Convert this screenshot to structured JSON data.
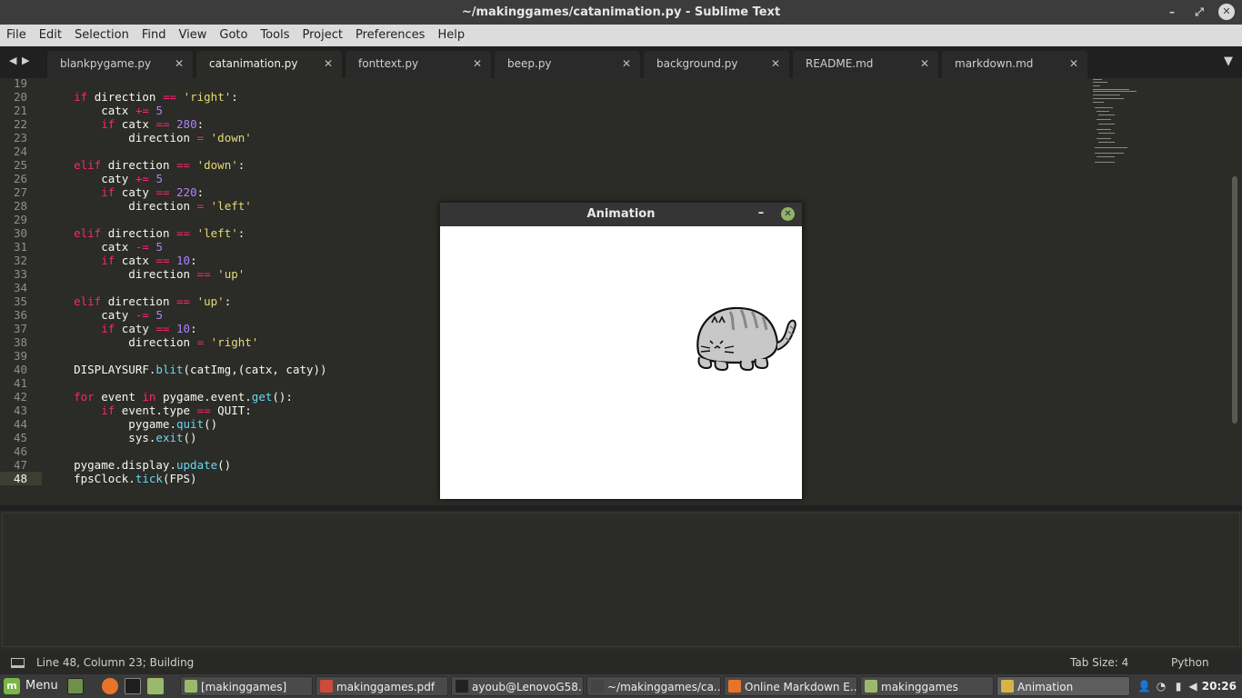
{
  "window": {
    "title": "~/makinggames/catanimation.py - Sublime Text"
  },
  "menu": [
    "File",
    "Edit",
    "Selection",
    "Find",
    "View",
    "Goto",
    "Tools",
    "Project",
    "Preferences",
    "Help"
  ],
  "tabs": [
    {
      "label": "blankpygame.py",
      "active": false
    },
    {
      "label": "catanimation.py",
      "active": true
    },
    {
      "label": "fonttext.py",
      "active": false
    },
    {
      "label": "beep.py",
      "active": false
    },
    {
      "label": "background.py",
      "active": false
    },
    {
      "label": "README.md",
      "active": false
    },
    {
      "label": "markdown.md",
      "active": false
    }
  ],
  "editor": {
    "current_line": "48",
    "lines": [
      {
        "n": "19",
        "html": ""
      },
      {
        "n": "20",
        "html": "    <span class=\"kw\">if</span> direction <span class=\"kw\">==</span> <span class=\"st\">'right'</span>:"
      },
      {
        "n": "21",
        "html": "        catx <span class=\"kw\">+=</span> <span class=\"nm\">5</span>"
      },
      {
        "n": "22",
        "html": "        <span class=\"kw\">if</span> catx <span class=\"kw\">==</span> <span class=\"nm\">280</span>:"
      },
      {
        "n": "23",
        "html": "            direction <span class=\"kw\">=</span> <span class=\"st\">'down'</span>"
      },
      {
        "n": "24",
        "html": ""
      },
      {
        "n": "25",
        "html": "    <span class=\"kw\">elif</span> direction <span class=\"kw\">==</span> <span class=\"st\">'down'</span>:"
      },
      {
        "n": "26",
        "html": "        caty <span class=\"kw\">+=</span> <span class=\"nm\">5</span>"
      },
      {
        "n": "27",
        "html": "        <span class=\"kw\">if</span> caty <span class=\"kw\">==</span> <span class=\"nm\">220</span>:"
      },
      {
        "n": "28",
        "html": "            direction <span class=\"kw\">=</span> <span class=\"st\">'left'</span>"
      },
      {
        "n": "29",
        "html": ""
      },
      {
        "n": "30",
        "html": "    <span class=\"kw\">elif</span> direction <span class=\"kw\">==</span> <span class=\"st\">'left'</span>:"
      },
      {
        "n": "31",
        "html": "        catx <span class=\"kw\">-=</span> <span class=\"nm\">5</span>"
      },
      {
        "n": "32",
        "html": "        <span class=\"kw\">if</span> catx <span class=\"kw\">==</span> <span class=\"nm\">10</span>:"
      },
      {
        "n": "33",
        "html": "            direction <span class=\"kw\">==</span> <span class=\"st\">'up'</span>"
      },
      {
        "n": "34",
        "html": ""
      },
      {
        "n": "35",
        "html": "    <span class=\"kw\">elif</span> direction <span class=\"kw\">==</span> <span class=\"st\">'up'</span>:"
      },
      {
        "n": "36",
        "html": "        caty <span class=\"kw\">-=</span> <span class=\"nm\">5</span>"
      },
      {
        "n": "37",
        "html": "        <span class=\"kw\">if</span> caty <span class=\"kw\">==</span> <span class=\"nm\">10</span>:"
      },
      {
        "n": "38",
        "html": "            direction <span class=\"kw\">=</span> <span class=\"st\">'right'</span>"
      },
      {
        "n": "39",
        "html": ""
      },
      {
        "n": "40",
        "html": "    DISPLAYSURF.<span class=\"fn\">blit</span>(catImg,(catx, caty))"
      },
      {
        "n": "41",
        "html": ""
      },
      {
        "n": "42",
        "html": "    <span class=\"kw\">for</span> event <span class=\"kw\">in</span> pygame.event.<span class=\"fn\">get</span>():"
      },
      {
        "n": "43",
        "html": "        <span class=\"kw\">if</span> event.type <span class=\"kw\">==</span> QUIT:"
      },
      {
        "n": "44",
        "html": "            pygame.<span class=\"fn\">quit</span>()"
      },
      {
        "n": "45",
        "html": "            sys.<span class=\"fn\">exit</span>()"
      },
      {
        "n": "46",
        "html": ""
      },
      {
        "n": "47",
        "html": "    pygame.display.<span class=\"fn\">update</span>()"
      },
      {
        "n": "48",
        "html": "    fpsClock.<span class=\"fn\">tick</span>(FPS)"
      }
    ]
  },
  "statusbar": {
    "position": "Line 48, Column 23; Building",
    "tab_size": "Tab Size: 4",
    "syntax": "Python"
  },
  "animation_window": {
    "title": "Animation",
    "minimize": "–",
    "close": "✕"
  },
  "taskbar": {
    "menu_label": "Menu",
    "tasks": [
      {
        "label": "[makinggames]",
        "icon_color": "#9cb86a",
        "active": false
      },
      {
        "label": "makinggames.pdf",
        "icon_color": "#d04a3a",
        "active": false
      },
      {
        "label": "ayoub@LenovoG58...",
        "icon_color": "#222222",
        "active": false
      },
      {
        "label": "~/makinggames/ca...",
        "icon_color": "#444444",
        "active": false
      },
      {
        "label": "Online Markdown E...",
        "icon_color": "#e8742a",
        "active": false
      },
      {
        "label": "makinggames",
        "icon_color": "#9cb86a",
        "active": false
      },
      {
        "label": "Animation",
        "icon_color": "#d8b34a",
        "active": true
      }
    ],
    "clock": "20:26"
  },
  "colors": {
    "accent": "#7ab648",
    "editor_bg": "#2b2b28",
    "keyword": "#f92672",
    "string": "#e6db74",
    "number": "#ae81ff",
    "function": "#66d9ef"
  }
}
